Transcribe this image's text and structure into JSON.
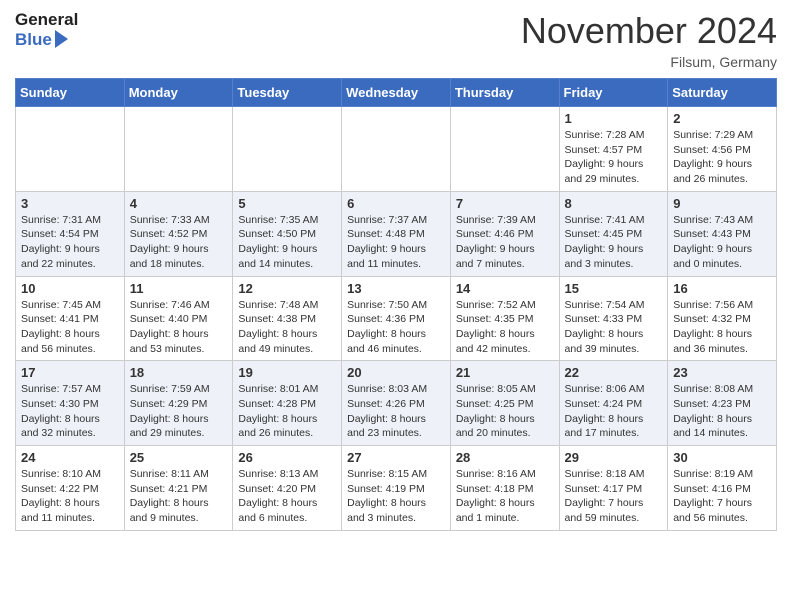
{
  "header": {
    "logo_line1": "General",
    "logo_line2": "Blue",
    "month": "November 2024",
    "location": "Filsum, Germany"
  },
  "weekdays": [
    "Sunday",
    "Monday",
    "Tuesday",
    "Wednesday",
    "Thursday",
    "Friday",
    "Saturday"
  ],
  "weeks": [
    [
      {
        "day": "",
        "info": ""
      },
      {
        "day": "",
        "info": ""
      },
      {
        "day": "",
        "info": ""
      },
      {
        "day": "",
        "info": ""
      },
      {
        "day": "",
        "info": ""
      },
      {
        "day": "1",
        "info": "Sunrise: 7:28 AM\nSunset: 4:57 PM\nDaylight: 9 hours\nand 29 minutes."
      },
      {
        "day": "2",
        "info": "Sunrise: 7:29 AM\nSunset: 4:56 PM\nDaylight: 9 hours\nand 26 minutes."
      }
    ],
    [
      {
        "day": "3",
        "info": "Sunrise: 7:31 AM\nSunset: 4:54 PM\nDaylight: 9 hours\nand 22 minutes."
      },
      {
        "day": "4",
        "info": "Sunrise: 7:33 AM\nSunset: 4:52 PM\nDaylight: 9 hours\nand 18 minutes."
      },
      {
        "day": "5",
        "info": "Sunrise: 7:35 AM\nSunset: 4:50 PM\nDaylight: 9 hours\nand 14 minutes."
      },
      {
        "day": "6",
        "info": "Sunrise: 7:37 AM\nSunset: 4:48 PM\nDaylight: 9 hours\nand 11 minutes."
      },
      {
        "day": "7",
        "info": "Sunrise: 7:39 AM\nSunset: 4:46 PM\nDaylight: 9 hours\nand 7 minutes."
      },
      {
        "day": "8",
        "info": "Sunrise: 7:41 AM\nSunset: 4:45 PM\nDaylight: 9 hours\nand 3 minutes."
      },
      {
        "day": "9",
        "info": "Sunrise: 7:43 AM\nSunset: 4:43 PM\nDaylight: 9 hours\nand 0 minutes."
      }
    ],
    [
      {
        "day": "10",
        "info": "Sunrise: 7:45 AM\nSunset: 4:41 PM\nDaylight: 8 hours\nand 56 minutes."
      },
      {
        "day": "11",
        "info": "Sunrise: 7:46 AM\nSunset: 4:40 PM\nDaylight: 8 hours\nand 53 minutes."
      },
      {
        "day": "12",
        "info": "Sunrise: 7:48 AM\nSunset: 4:38 PM\nDaylight: 8 hours\nand 49 minutes."
      },
      {
        "day": "13",
        "info": "Sunrise: 7:50 AM\nSunset: 4:36 PM\nDaylight: 8 hours\nand 46 minutes."
      },
      {
        "day": "14",
        "info": "Sunrise: 7:52 AM\nSunset: 4:35 PM\nDaylight: 8 hours\nand 42 minutes."
      },
      {
        "day": "15",
        "info": "Sunrise: 7:54 AM\nSunset: 4:33 PM\nDaylight: 8 hours\nand 39 minutes."
      },
      {
        "day": "16",
        "info": "Sunrise: 7:56 AM\nSunset: 4:32 PM\nDaylight: 8 hours\nand 36 minutes."
      }
    ],
    [
      {
        "day": "17",
        "info": "Sunrise: 7:57 AM\nSunset: 4:30 PM\nDaylight: 8 hours\nand 32 minutes."
      },
      {
        "day": "18",
        "info": "Sunrise: 7:59 AM\nSunset: 4:29 PM\nDaylight: 8 hours\nand 29 minutes."
      },
      {
        "day": "19",
        "info": "Sunrise: 8:01 AM\nSunset: 4:28 PM\nDaylight: 8 hours\nand 26 minutes."
      },
      {
        "day": "20",
        "info": "Sunrise: 8:03 AM\nSunset: 4:26 PM\nDaylight: 8 hours\nand 23 minutes."
      },
      {
        "day": "21",
        "info": "Sunrise: 8:05 AM\nSunset: 4:25 PM\nDaylight: 8 hours\nand 20 minutes."
      },
      {
        "day": "22",
        "info": "Sunrise: 8:06 AM\nSunset: 4:24 PM\nDaylight: 8 hours\nand 17 minutes."
      },
      {
        "day": "23",
        "info": "Sunrise: 8:08 AM\nSunset: 4:23 PM\nDaylight: 8 hours\nand 14 minutes."
      }
    ],
    [
      {
        "day": "24",
        "info": "Sunrise: 8:10 AM\nSunset: 4:22 PM\nDaylight: 8 hours\nand 11 minutes."
      },
      {
        "day": "25",
        "info": "Sunrise: 8:11 AM\nSunset: 4:21 PM\nDaylight: 8 hours\nand 9 minutes."
      },
      {
        "day": "26",
        "info": "Sunrise: 8:13 AM\nSunset: 4:20 PM\nDaylight: 8 hours\nand 6 minutes."
      },
      {
        "day": "27",
        "info": "Sunrise: 8:15 AM\nSunset: 4:19 PM\nDaylight: 8 hours\nand 3 minutes."
      },
      {
        "day": "28",
        "info": "Sunrise: 8:16 AM\nSunset: 4:18 PM\nDaylight: 8 hours\nand 1 minute."
      },
      {
        "day": "29",
        "info": "Sunrise: 8:18 AM\nSunset: 4:17 PM\nDaylight: 7 hours\nand 59 minutes."
      },
      {
        "day": "30",
        "info": "Sunrise: 8:19 AM\nSunset: 4:16 PM\nDaylight: 7 hours\nand 56 minutes."
      }
    ]
  ]
}
